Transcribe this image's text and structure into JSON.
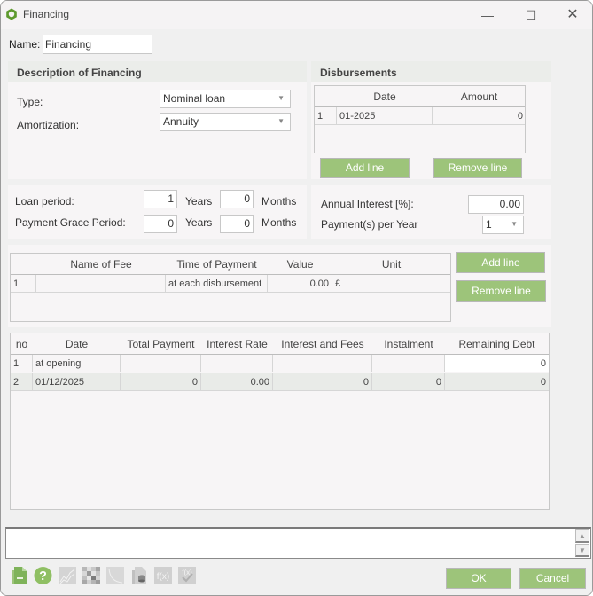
{
  "window": {
    "title": "Financing",
    "minimize_glyph": "—",
    "maximize_glyph": "☐",
    "close_glyph": "✕"
  },
  "name_field": {
    "label": "Name:",
    "value": "Financing"
  },
  "description": {
    "header": "Description of Financing",
    "type_label": "Type:",
    "type_value": "Nominal loan",
    "amortization_label": "Amortization:",
    "amortization_value": "Annuity"
  },
  "disbursements": {
    "header": "Disbursements",
    "columns": [
      "",
      "Date",
      "Amount"
    ],
    "rows": [
      {
        "no": "1",
        "date": "01-2025",
        "amount": "0"
      }
    ],
    "add_label": "Add line",
    "remove_label": "Remove line"
  },
  "periods": {
    "loan_period_label": "Loan period:",
    "loan_years": "1",
    "loan_months": "0",
    "grace_label": "Payment Grace Period:",
    "grace_years": "0",
    "grace_months": "0",
    "years_unit": "Years",
    "months_unit": "Months"
  },
  "interest": {
    "annual_label": "Annual Interest [%]:",
    "annual_value": "0.00",
    "payments_label": "Payment(s) per Year",
    "payments_value": "1"
  },
  "fees": {
    "columns": [
      "",
      "Name of Fee",
      "Time of Payment",
      "Value",
      "Unit"
    ],
    "rows": [
      {
        "no": "1",
        "name": "",
        "time": "at each disbursement",
        "value": "0.00",
        "unit": "£"
      }
    ],
    "add_label": "Add line",
    "remove_label": "Remove line"
  },
  "schedule": {
    "columns": [
      "no",
      "Date",
      "Total Payment",
      "Interest Rate",
      "Interest and Fees",
      "Instalment",
      "Remaining Debt"
    ],
    "rows": [
      {
        "no": "1",
        "date": "at opening",
        "total": "",
        "rate": "",
        "interest": "",
        "instalment": "",
        "remaining": "0"
      },
      {
        "no": "2",
        "date": "01/12/2025",
        "total": "0",
        "rate": "0.00",
        "interest": "0",
        "instalment": "0",
        "remaining": "0"
      }
    ]
  },
  "notes": {
    "value": "",
    "scroll_up": "▲",
    "scroll_down": "▼"
  },
  "toolbar": {
    "icons": [
      "export-document-icon",
      "help-icon",
      "chart-icon",
      "matrix-icon",
      "curve-icon",
      "database-document-icon",
      "function-icon",
      "function-check-icon"
    ],
    "fx_label": "f(x)",
    "help_glyph": "?"
  },
  "footer": {
    "ok_label": "OK",
    "cancel_label": "Cancel"
  },
  "colors": {
    "accent_green": "#9dc47a",
    "panel_header": "#ebedea",
    "panel_bg": "#f7f5f6",
    "alt_row": "#e9ebe8"
  }
}
